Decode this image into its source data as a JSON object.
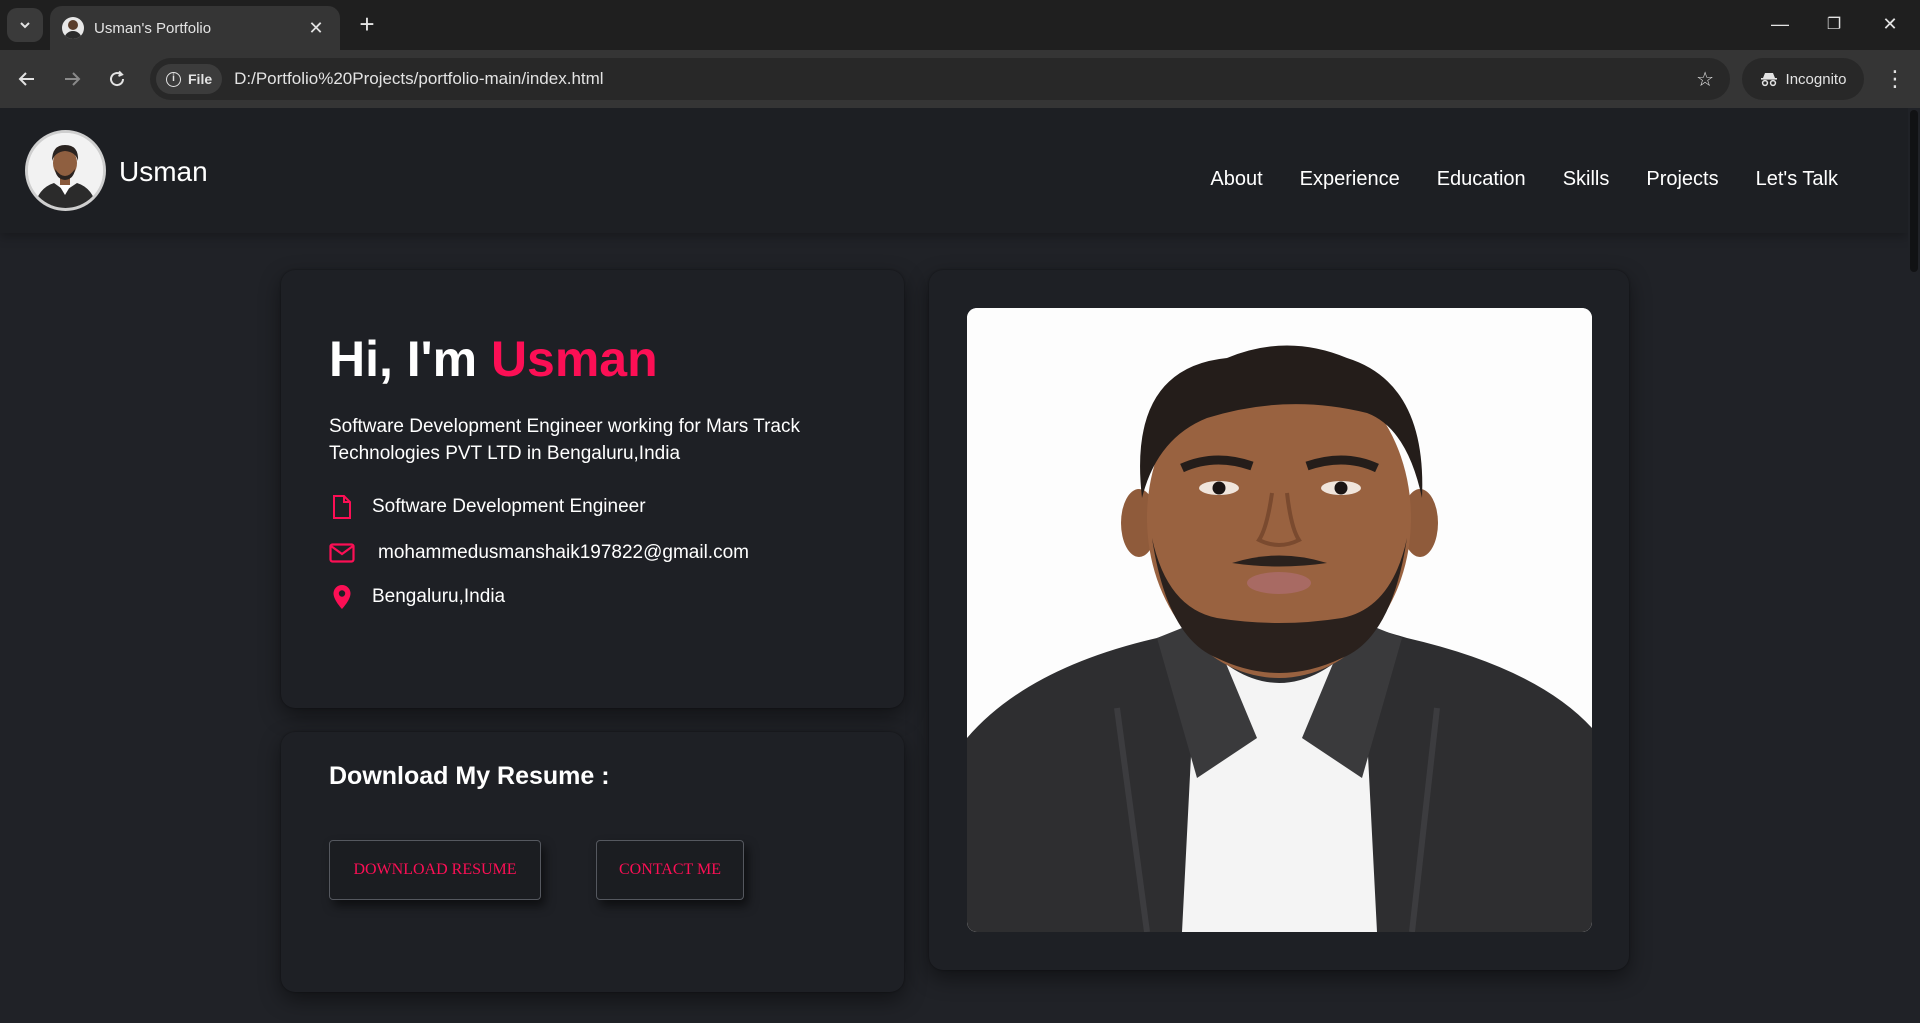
{
  "browser": {
    "tab_title": "Usman's Portfolio",
    "tab_close": "✕",
    "new_tab": "+",
    "site_chip": "File",
    "url": "D:/Portfolio%20Projects/portfolio-main/index.html",
    "profile_label": "Incognito",
    "window_minimize": "—",
    "window_restore": "❐",
    "window_close": "✕"
  },
  "site": {
    "brand": "Usman",
    "nav": [
      "About",
      "Experience",
      "Education",
      "Skills",
      "Projects",
      "Let's Talk"
    ]
  },
  "intro": {
    "greeting": "Hi, I'm",
    "name": "Usman",
    "description": "Software Development Engineer working for Mars Track Technologies PVT LTD in Bengaluru,India",
    "items": [
      {
        "icon": "document-icon",
        "text": "Software Development Engineer"
      },
      {
        "icon": "envelope-icon",
        "text": "mohammedusmanshaik197822@gmail.com"
      },
      {
        "icon": "location-pin-icon",
        "text": "Bengaluru,India"
      }
    ]
  },
  "resume": {
    "title": "Download My Resume :",
    "download_label": "DOWNLOAD RESUME",
    "contact_label": "CONTACT ME"
  },
  "colors": {
    "accent": "#fc0f55",
    "page_background": "#202227",
    "card_background": "#1e2025"
  }
}
